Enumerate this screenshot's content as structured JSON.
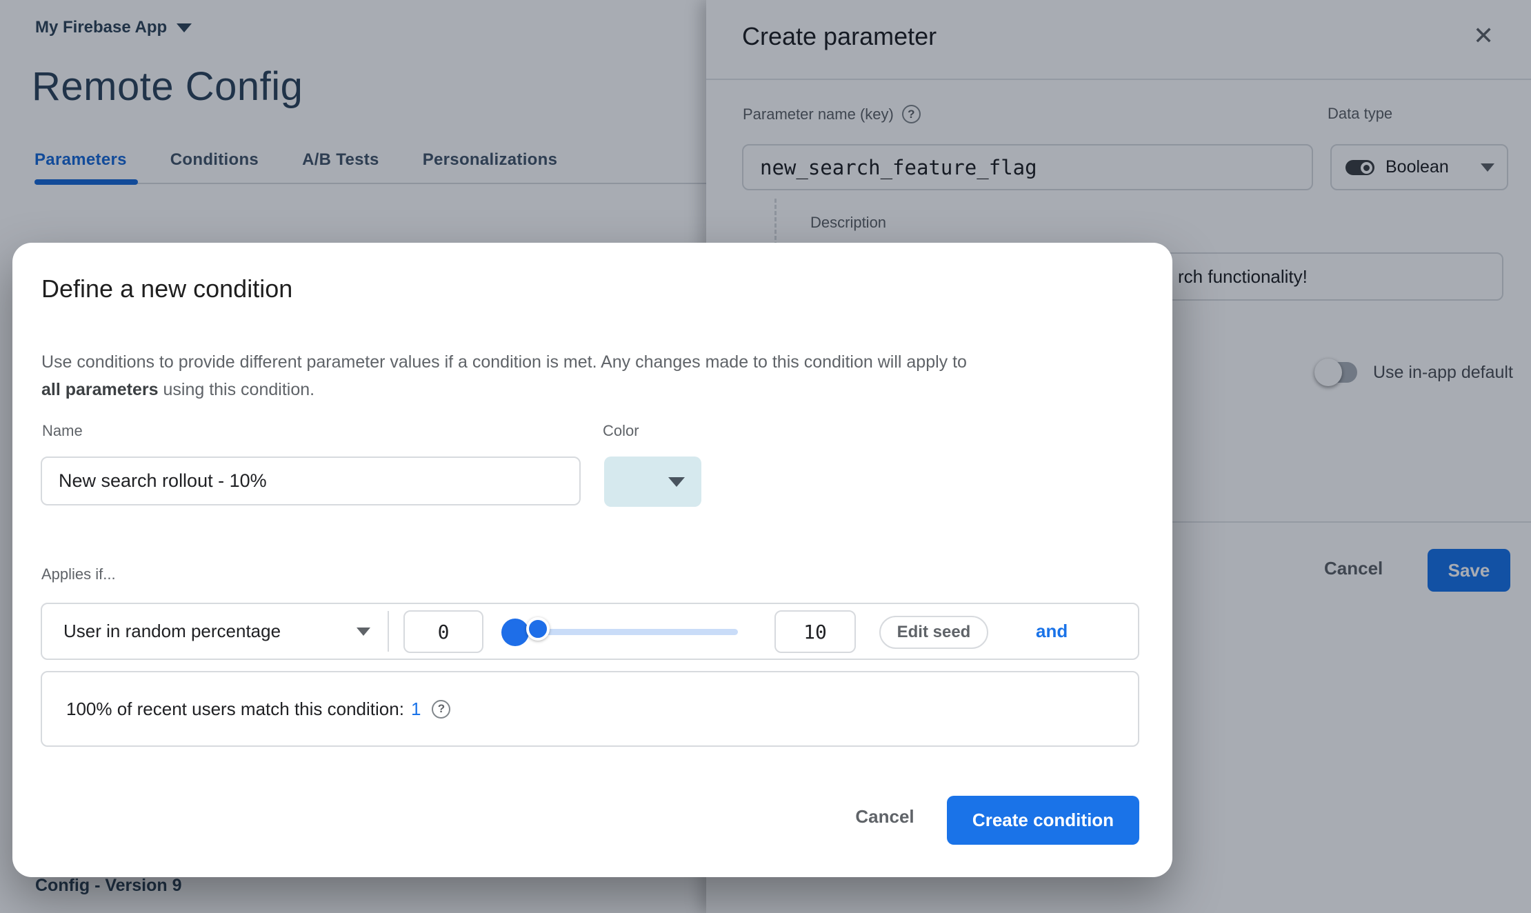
{
  "page": {
    "app_name": "My Firebase App",
    "title": "Remote Config",
    "tabs": [
      {
        "label": "Parameters",
        "active": true
      },
      {
        "label": "Conditions",
        "active": false
      },
      {
        "label": "A/B Tests",
        "active": false
      },
      {
        "label": "Personalizations",
        "active": false
      }
    ],
    "footer_heading": "Config - Version 9"
  },
  "panel": {
    "title": "Create parameter",
    "param_name": {
      "label": "Parameter name (key)",
      "value": "new_search_feature_flag"
    },
    "data_type": {
      "label": "Data type",
      "value": "Boolean"
    },
    "description": {
      "label": "Description",
      "visible_value": "rch functionality!"
    },
    "in_app_default_label": "Use in-app default",
    "in_app_default_state": "off",
    "cancel_label": "Cancel",
    "save_label": "Save"
  },
  "modal": {
    "title": "Define a new condition",
    "description_line1": "Use conditions to provide different parameter values if a condition is met. Any changes made to this condition will apply to",
    "description_bold": "all parameters",
    "description_line2_rest": " using this condition.",
    "name": {
      "label": "Name",
      "value": "New search rollout - 10%"
    },
    "color_label": "Color",
    "applies_if_label": "Applies if...",
    "condition": {
      "type": "User in random percentage",
      "percent_from": "0",
      "percent_to": "10",
      "edit_seed_label": "Edit seed",
      "and_label": "and"
    },
    "match_info": {
      "text": "100% of recent users match this condition:",
      "value": "1"
    },
    "cancel_label": "Cancel",
    "create_label": "Create condition"
  },
  "icons": {
    "close": "✕",
    "help": "?"
  },
  "colors": {
    "primary_blue": "#1a73e8",
    "slider_track_light": "#c9dcf8",
    "color_swatch": "#d6e9ee",
    "heading_navy": "#2f455c",
    "border_gray": "#dadce0",
    "text_gray": "#5f6368",
    "text_dark": "#202124"
  }
}
